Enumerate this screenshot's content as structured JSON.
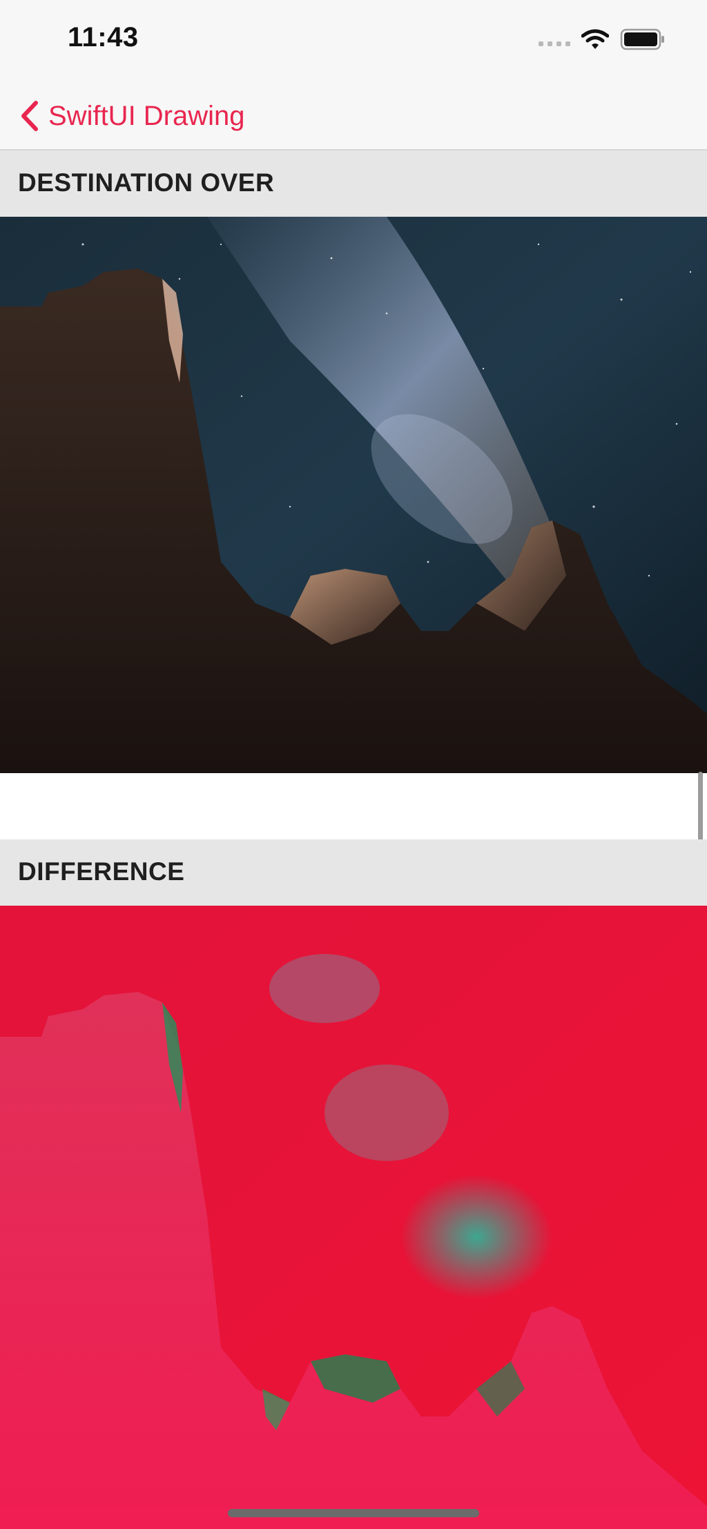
{
  "status_bar": {
    "time": "11:43",
    "icons": [
      "cellular-signal-icon",
      "wifi-icon",
      "battery-icon"
    ]
  },
  "nav": {
    "back_label": "SwiftUI Drawing",
    "accent_color": "#e8264f"
  },
  "sections": [
    {
      "title": "DESTINATION OVER",
      "image": "night-sky-rock-spires-photo"
    },
    {
      "title": "DIFFERENCE",
      "image": "difference-blend-red-photo"
    }
  ]
}
